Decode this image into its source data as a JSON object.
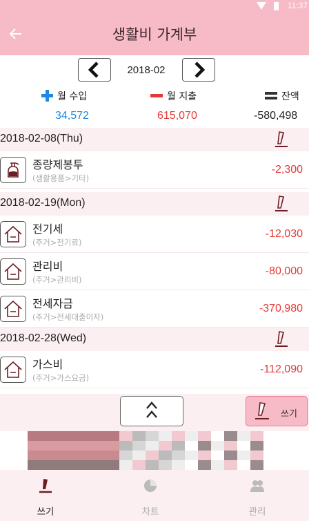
{
  "status_bar": {
    "time": "11:37"
  },
  "app_bar": {
    "back_label": "←",
    "title": "생활비 가계부"
  },
  "month_nav": {
    "prev_label": "<",
    "month": "2018-02",
    "next_label": ">"
  },
  "summary": {
    "income_label": "월 수입",
    "income_value": "34,572",
    "income_color": "#1e88e5",
    "expense_label": "월 지출",
    "expense_value": "615,070",
    "expense_color": "#e53935",
    "balance_label": "잔액",
    "balance_value": "-580,498"
  },
  "groups": [
    {
      "date": "2018-02-08(Thu)",
      "entries": [
        {
          "title": "종량제봉투",
          "category": "(생활용품>기타)",
          "amount": "-2,300",
          "icon": "bottle-icon"
        }
      ]
    },
    {
      "date": "2018-02-19(Mon)",
      "entries": [
        {
          "title": "전기세",
          "category": "(주거>전기료)",
          "amount": "-12,030",
          "icon": "house-icon"
        },
        {
          "title": "관리비",
          "category": "(주거>관리비)",
          "amount": "-80,000",
          "icon": "house-icon"
        },
        {
          "title": "전세자금",
          "category": "(주거>전세대출이자)",
          "amount": "-370,980",
          "icon": "house-icon"
        }
      ]
    },
    {
      "date": "2018-02-28(Wed)",
      "entries": [
        {
          "title": "가스비",
          "category": "(주거>가스요금)",
          "amount": "-112,090",
          "icon": "house-icon"
        }
      ]
    }
  ],
  "scroll_top": {
    "label": "^\n^"
  },
  "write_fab": {
    "label": "쓰기"
  },
  "bottom_nav": {
    "tabs": [
      {
        "label": "쓰기",
        "icon": "pen-icon",
        "active": true
      },
      {
        "label": "차트",
        "icon": "pie-chart-icon",
        "active": false
      },
      {
        "label": "관리",
        "icon": "people-icon",
        "active": false
      }
    ]
  },
  "colors": {
    "app_bar": "#f7bac7",
    "section_bg": "#fbeff1",
    "expense": "#e53935",
    "income": "#1e88e5"
  }
}
